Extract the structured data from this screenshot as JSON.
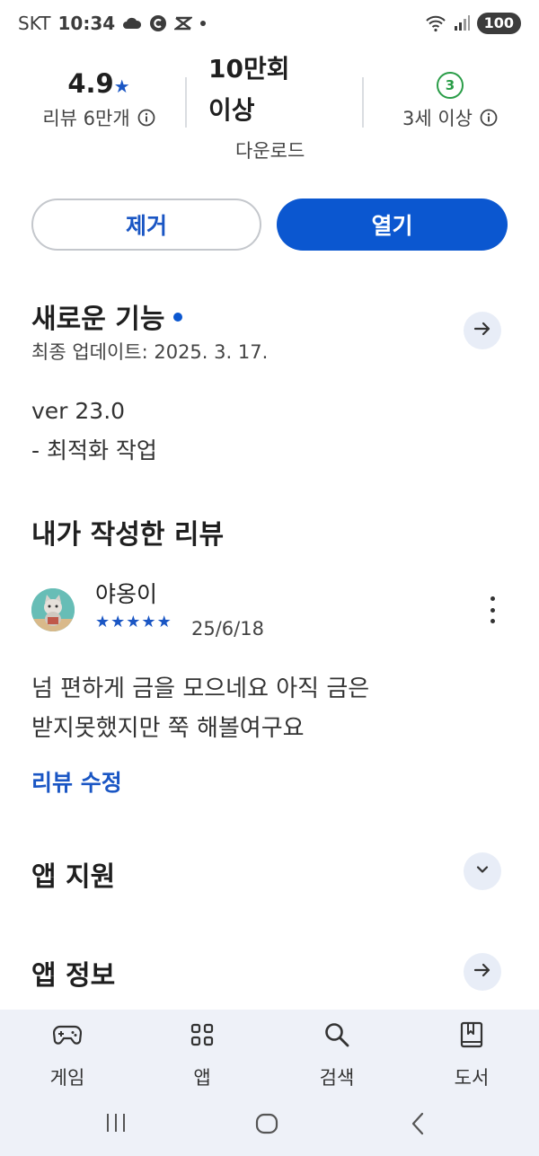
{
  "status_bar": {
    "carrier": "SKT",
    "time": "10:34",
    "battery": "100",
    "icons": [
      "cloud-icon",
      "c-badge-icon",
      "capcut-icon",
      "dot-icon",
      "wifi-6-icon",
      "signal-icon"
    ]
  },
  "stats": {
    "rating": "4.9",
    "rating_star": "★",
    "reviews_label": "리뷰 6만개",
    "downloads_line1": "10만회",
    "downloads_line2": "이상",
    "downloads_label": "다운로드",
    "age_badge": "3",
    "age_label": "3세 이상"
  },
  "buttons": {
    "remove": "제거",
    "open": "열기"
  },
  "whats_new": {
    "title": "새로운 기능",
    "updated": "최종 업데이트: 2025. 3. 17.",
    "notes_line1": "ver 23.0",
    "notes_line2": "- 최적화 작업"
  },
  "my_review": {
    "title": "내가 작성한 리뷰",
    "reviewer": "야옹이",
    "rating": 5,
    "stars": [
      "★",
      "★",
      "★",
      "★",
      "★"
    ],
    "date": "25/6/18",
    "text_line1": "넘 편하게 금을 모으네요 아직 금은",
    "text_line2": "받지못했지만 쭉 해볼여구요",
    "edit_link": "리뷰 수정"
  },
  "app_support": {
    "title": "앱 지원"
  },
  "app_info": {
    "title": "앱 정보"
  },
  "bottom_nav": {
    "items": [
      {
        "label": "게임",
        "icon": "gamepad-icon"
      },
      {
        "label": "앱",
        "icon": "apps-grid-icon"
      },
      {
        "label": "검색",
        "icon": "search-icon"
      },
      {
        "label": "도서",
        "icon": "book-icon"
      }
    ]
  },
  "colors": {
    "accent": "#0b57d0",
    "link": "#1a56c4",
    "age_green": "#2a9d48",
    "nav_bg": "#eef1f8"
  }
}
